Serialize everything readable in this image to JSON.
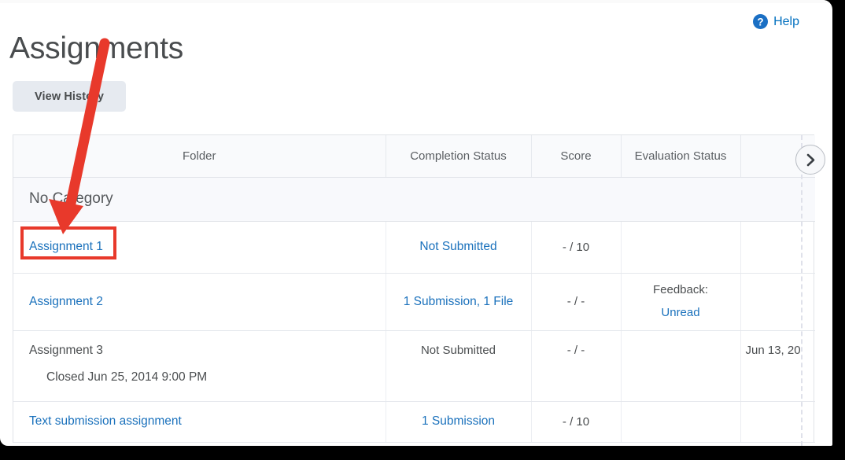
{
  "page": {
    "title": "Assignments"
  },
  "help": {
    "label": "Help",
    "icon": "question-circle-icon",
    "color": "#006fbf"
  },
  "toolbar": {
    "view_history_label": "View History"
  },
  "table": {
    "columns": [
      "Folder",
      "Completion Status",
      "Score",
      "Evaluation Status",
      ""
    ],
    "scroll_right_label": "›",
    "category_label": "No Category",
    "rows": [
      {
        "name": "Assignment 1",
        "name_is_link": true,
        "sub": "",
        "completion": "Not Submitted",
        "completion_is_link": true,
        "score": "- / 10",
        "eval_label": "",
        "eval_value": "",
        "due": ""
      },
      {
        "name": "Assignment 2",
        "name_is_link": true,
        "sub": "",
        "completion": "1 Submission, 1 File",
        "completion_is_link": true,
        "score": "- / -",
        "eval_label": "Feedback:",
        "eval_value": "Unread",
        "due": ""
      },
      {
        "name": "Assignment 3",
        "name_is_link": false,
        "sub": "Closed Jun 25, 2014 9:00 PM",
        "completion": "Not Submitted",
        "completion_is_link": false,
        "score": "- / -",
        "eval_label": "",
        "eval_value": "",
        "due": "Jun 13, 20"
      },
      {
        "name": "Text submission assignment",
        "name_is_link": true,
        "sub": "",
        "completion": "1 Submission",
        "completion_is_link": true,
        "score": "- / 10",
        "eval_label": "",
        "eval_value": "",
        "due": ""
      }
    ]
  },
  "annotations": {
    "arrow_color": "#e8392b",
    "box_color": "#e8392b",
    "arrow_from": "133,53",
    "arrow_to": "82,292",
    "highlight_target": "Assignment 1"
  }
}
